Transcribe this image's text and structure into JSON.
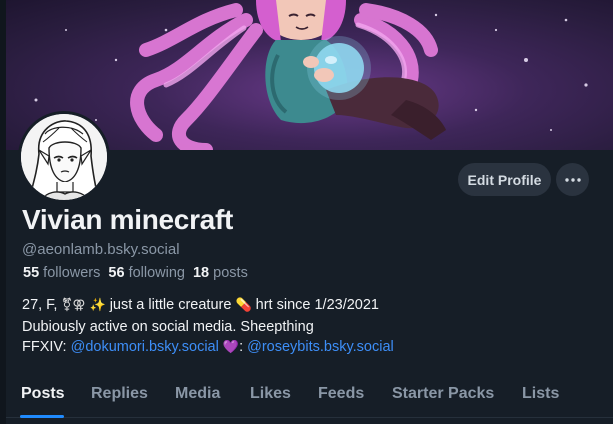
{
  "profile": {
    "display_name": "Vivian minecraft",
    "handle": "@aeonlamb.bsky.social",
    "followers_count": "55",
    "followers_label": "followers",
    "following_count": "56",
    "following_label": "following",
    "posts_count": "18",
    "posts_label": "posts"
  },
  "bio": {
    "line1_prefix": "27, F,",
    "line1_symbol": "⚧⚢",
    "line1_sparkle": "✨",
    "line1_text": "just a little creature",
    "line1_pill": "💊",
    "line1_suffix": "hrt since 1/23/2021",
    "line2": "Dubiously active on social media. Sheepthing",
    "line3_prefix": "FFXIV:",
    "line3_link1": "@dokumori.bsky.social",
    "line3_heart": "💜",
    "line3_sep": ":",
    "line3_link2": "@roseybits.bsky.social"
  },
  "actions": {
    "edit_profile_label": "Edit Profile",
    "more_icon": "ellipsis-icon"
  },
  "tabs": [
    {
      "label": "Posts",
      "active": true
    },
    {
      "label": "Replies",
      "active": false
    },
    {
      "label": "Media",
      "active": false
    },
    {
      "label": "Likes",
      "active": false
    },
    {
      "label": "Feeds",
      "active": false
    },
    {
      "label": "Starter Packs",
      "active": false
    },
    {
      "label": "Lists",
      "active": false
    }
  ],
  "colors": {
    "background": "#161e27",
    "link": "#3d8ef7",
    "tab_indicator": "#208bfe",
    "muted_text": "#8a97a6"
  }
}
